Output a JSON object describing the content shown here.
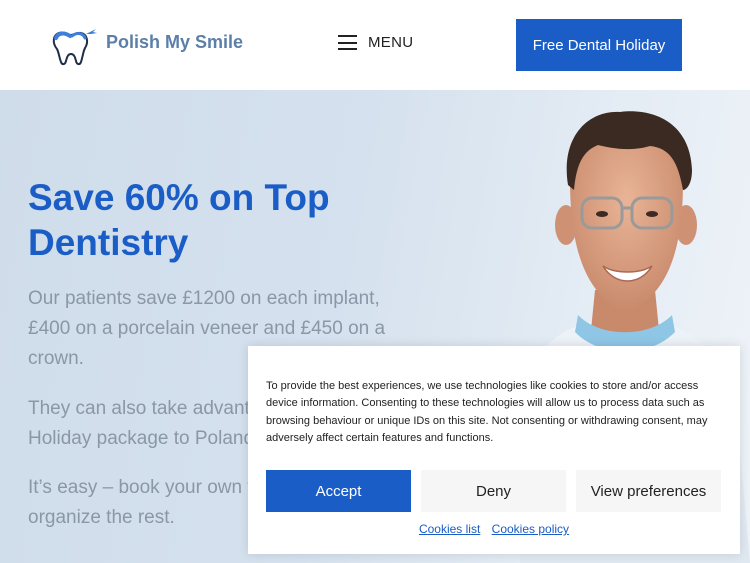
{
  "header": {
    "logo_text": "Polish My Smile",
    "menu_label": "MENU",
    "cta_label": "Free Dental Holiday"
  },
  "hero": {
    "title": "Save 60% on Top Dentistry",
    "paragraph_1": "Our patients save £1200 on each implant, £400 on a porcelain veneer and £450 on a crown.",
    "paragraph_2": "They can also take advantage of our Dental Holiday package to Poland.",
    "paragraph_3": "It’s easy – book your own flight and we organize the rest."
  },
  "cookie_banner": {
    "text": "To provide the best experiences, we use technologies like cookies to store and/or access device information. Consenting to these technologies will allow us to process data such as browsing behaviour or unique IDs on this site. Not consenting or withdrawing consent, may adversely affect certain features and functions.",
    "accept_label": "Accept",
    "deny_label": "Deny",
    "preferences_label": "View preferences",
    "cookies_list_label": "Cookies list",
    "cookies_policy_label": "Cookies policy"
  },
  "colors": {
    "brand_blue": "#1a5dc6",
    "logo_text": "#5b7fa8",
    "hero_text_grey": "#8a97a6"
  }
}
